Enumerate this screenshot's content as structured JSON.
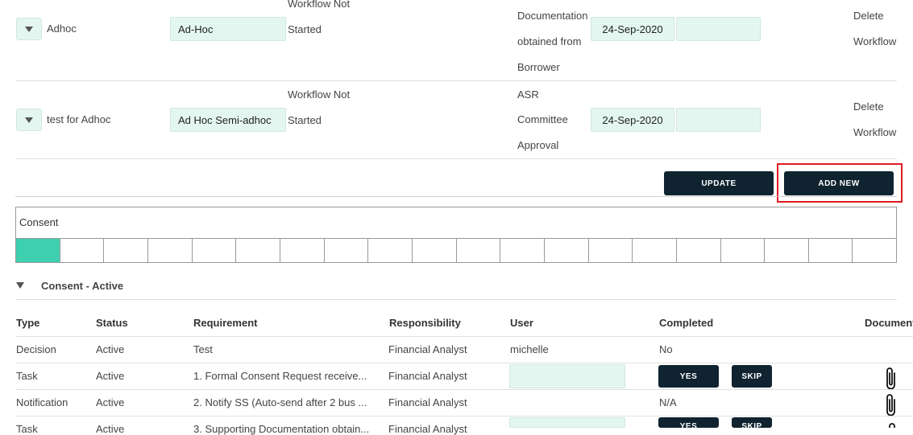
{
  "workflows": [
    {
      "name": "Adhoc",
      "type": "Ad-Hoc",
      "status_lines": [
        "Workflow Not",
        "Started"
      ],
      "desc_lines": [
        "Documentation",
        "obtained from",
        "Borrower"
      ],
      "date": "24-Sep-2020",
      "date2": "",
      "delete_lines": [
        "Delete",
        "Workflow"
      ]
    },
    {
      "name": "test for Adhoc",
      "type": "Ad Hoc Semi-adhoc",
      "status_lines": [
        "Workflow Not",
        "Started"
      ],
      "desc_lines": [
        "ASR",
        "Committee",
        "Approval"
      ],
      "date": "24-Sep-2020",
      "date2": "",
      "delete_lines": [
        "Delete",
        "Workflow"
      ]
    }
  ],
  "buttons": {
    "update": "UPDATE",
    "add_new": "ADD NEW"
  },
  "consent": {
    "title": "Consent",
    "segments_total": 20,
    "segments_filled": 1,
    "fill_color": "#3ecfae"
  },
  "section": {
    "title": "Consent - Active"
  },
  "table": {
    "headers": [
      "Type",
      "Status",
      "Requirement",
      "Responsibility",
      "User",
      "Completed",
      "Document"
    ],
    "rows": [
      {
        "type": "Decision",
        "status": "Active",
        "requirement": "Test",
        "responsibility": "Financial Analyst",
        "user": "michelle",
        "completed": "No"
      },
      {
        "type": "Task",
        "status": "Active",
        "requirement": "1. Formal Consent Request receive...",
        "responsibility": "Financial Analyst",
        "user": "",
        "completed": "",
        "yes": "YES",
        "skip": "SKIP"
      },
      {
        "type": "Notification",
        "status": "Active",
        "requirement": "2. Notify SS (Auto-send after 2 bus ...",
        "responsibility": "Financial Analyst",
        "user": "",
        "completed": "N/A"
      },
      {
        "type": "Task",
        "status": "Active",
        "requirement": "3. Supporting Documentation obtain...",
        "responsibility": "Financial Analyst",
        "user": "",
        "completed": "",
        "yes": "YES",
        "skip": "SKIP"
      }
    ]
  }
}
